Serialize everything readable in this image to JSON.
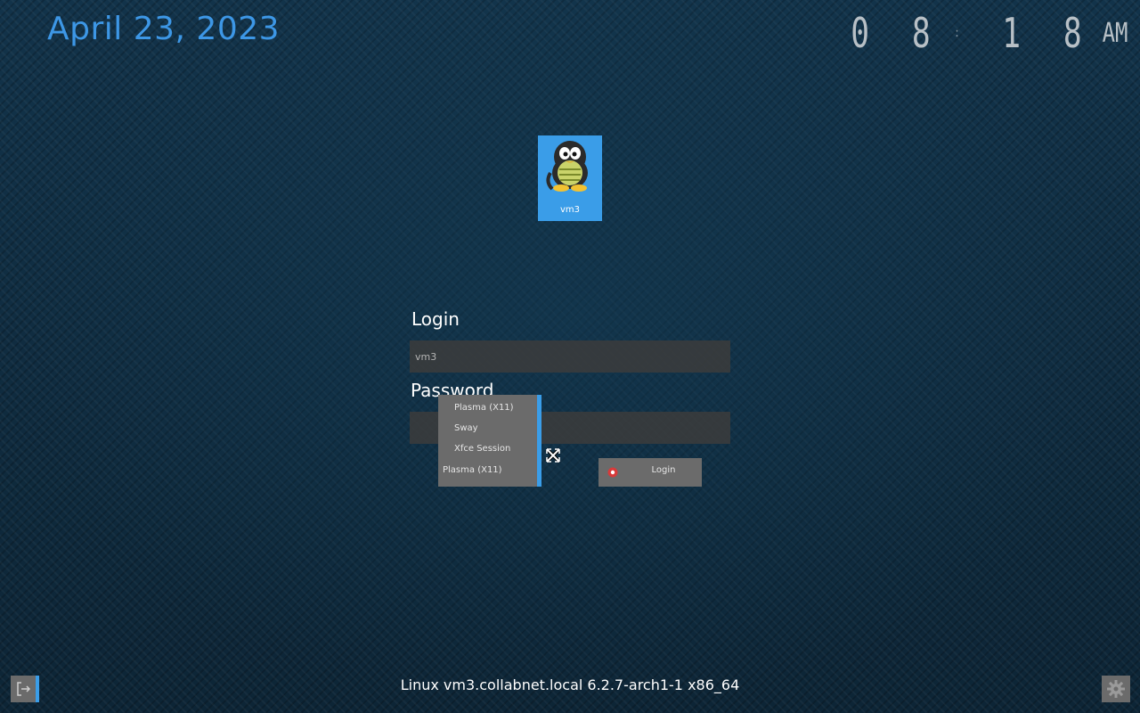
{
  "header": {
    "date": "April 23, 2023",
    "time_digits": "08:18",
    "time_display_hours": "0 8",
    "time_display_minutes": "1 8",
    "time_separator": ":",
    "ampm": "AM"
  },
  "user": {
    "username": "vm3",
    "avatar_icon": "tux-penguin-icon"
  },
  "form": {
    "login_label": "Login",
    "login_value": "vm3",
    "password_label": "Password",
    "password_value": ""
  },
  "session": {
    "options": [
      "Plasma (X11)",
      "Sway",
      "Xfce Session"
    ],
    "selected": "Plasma (X11)"
  },
  "login_button": {
    "label": "Login",
    "icon": "record-dot-icon"
  },
  "footer": {
    "system_info": "Linux vm3.collabnet.local 6.2.7-arch1-1 x86_64",
    "left_icon": "logout-icon",
    "right_icon": "gear-icon"
  },
  "colors": {
    "accent": "#3a9de8",
    "date": "#3d97e6",
    "panel": "#6b6b6b",
    "field": "#3c3c3c"
  }
}
